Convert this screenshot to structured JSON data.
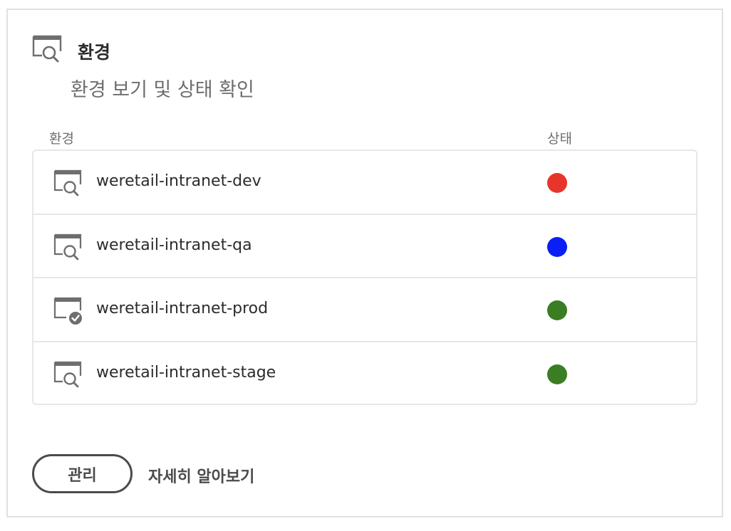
{
  "header": {
    "icon": "environment-search-icon",
    "title": "환경",
    "subtitle": "환경 보기 및 상태 확인"
  },
  "columns": {
    "environment": "환경",
    "status": "상태"
  },
  "environments": [
    {
      "name": "weretail-intranet-dev",
      "icon": "environment-search-icon",
      "status_color": "#e8352b"
    },
    {
      "name": "weretail-intranet-qa",
      "icon": "environment-search-icon",
      "status_color": "#0a1ff5"
    },
    {
      "name": "weretail-intranet-prod",
      "icon": "environment-check-icon",
      "status_color": "#3a7d23"
    },
    {
      "name": "weretail-intranet-stage",
      "icon": "environment-search-icon",
      "status_color": "#3a7d23"
    }
  ],
  "footer": {
    "manage_label": "관리",
    "learn_more_label": "자세히 알아보기"
  }
}
